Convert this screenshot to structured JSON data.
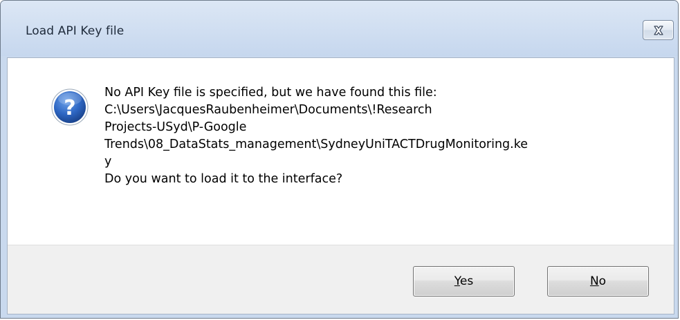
{
  "window": {
    "title": "Load API Key file"
  },
  "dialog": {
    "icon": "question-icon",
    "message_lines": [
      "No API Key file is specified, but we have found this file:",
      "C:\\Users\\JacquesRaubenheimer\\Documents\\!Research",
      "Projects-USyd\\P-Google",
      "Trends\\08_DataStats_management\\SydneyUniTACTDrugMonitoring.ke",
      "y",
      "Do you want to load it to the interface?"
    ]
  },
  "buttons": {
    "yes_label": "Yes",
    "no_label": "No"
  },
  "colors": {
    "frame": "#c9d9ee",
    "icon_blue": "#2a5fb0",
    "footer": "#f0f0f0"
  }
}
